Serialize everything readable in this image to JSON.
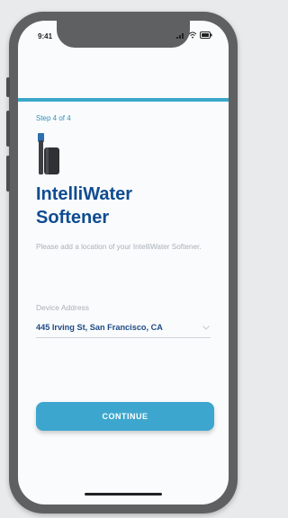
{
  "status_bar": {
    "time": "9:41",
    "icons": [
      "signal-icon",
      "wifi-icon",
      "battery-icon"
    ]
  },
  "accent_color": "#3aa7c9",
  "step_label": "Step 4 of 4",
  "product_icon": "water-softener-icon",
  "title_line1": "IntelliWater",
  "title_line2": "Softener",
  "description": "Please add a location of your IntelliWater Softener.",
  "address": {
    "label": "Device Address",
    "value": "445 Irving St, San Francisco, CA",
    "icon": "chevron-down-icon"
  },
  "continue_label": "CONTINUE"
}
